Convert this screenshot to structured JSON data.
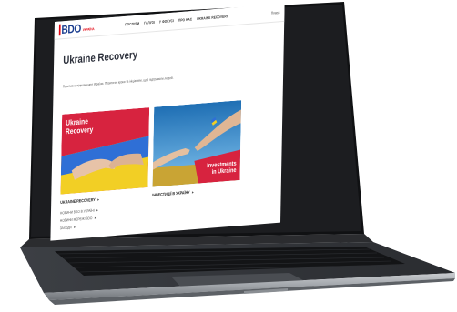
{
  "header": {
    "logo": "BDO",
    "logo_sub": "УКРАЇНА",
    "nav": [
      "ПОСЛУГИ",
      "ГАЛУЗІ",
      "У ФОКУСІ",
      "ПРО НАС",
      "UKRAINE RECOVERY"
    ],
    "lang": "Пошук"
  },
  "page": {
    "title": "Ukraine Recovery",
    "intro": "Позитивне відновлення України. Практичні кроки та ініціативи, щоб підтримати людей."
  },
  "cards": [
    {
      "title_line1": "Ukraine",
      "title_line2": "Recovery",
      "link": "UKRAINE RECOVERY",
      "sub_links": [
        "НОВИНИ BDO В УКРАЇНІ",
        "НОВИНИ МЕРЕЖІ BDO",
        "ЗАХОДИ"
      ]
    },
    {
      "title_line1": "Investments",
      "title_line2": "in Ukraine",
      "link": "ІНВЕСТИЦІЇ В УКРАЇНУ"
    }
  ],
  "colors": {
    "brand_blue": "#1a3d8f",
    "brand_red": "#e30613",
    "flag_blue": "#2f6fd6",
    "flag_yellow": "#f2cf25",
    "card_red": "#d7233f"
  },
  "icons": [
    "chevron-right-icon"
  ]
}
